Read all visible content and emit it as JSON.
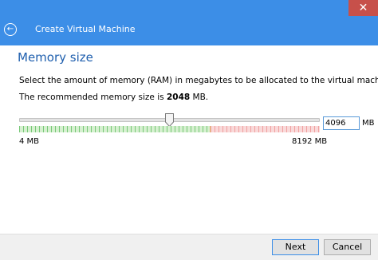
{
  "window": {
    "title": "Create Virtual Machine",
    "close_glyph": "✕",
    "back_glyph": "←"
  },
  "page": {
    "heading": "Memory size",
    "description": "Select the amount of memory (RAM) in megabytes to be allocated to the virtual machine.",
    "recommend_prefix": "The recommended memory size is ",
    "recommend_value": "2048",
    "recommend_suffix": " MB."
  },
  "memory": {
    "value": "4096",
    "unit": "MB",
    "min_label": "4 MB",
    "max_label": "8192 MB",
    "min_mb": 4,
    "max_mb": 8192,
    "current_mb": 4096
  },
  "buttons": {
    "next": "Next",
    "cancel": "Cancel"
  },
  "colors": {
    "title_bar": "#3c8ee7",
    "close_button": "#c7504a",
    "heading": "#1f5fae",
    "scale_ok": "#78c878",
    "scale_high": "#f0a0a0"
  }
}
